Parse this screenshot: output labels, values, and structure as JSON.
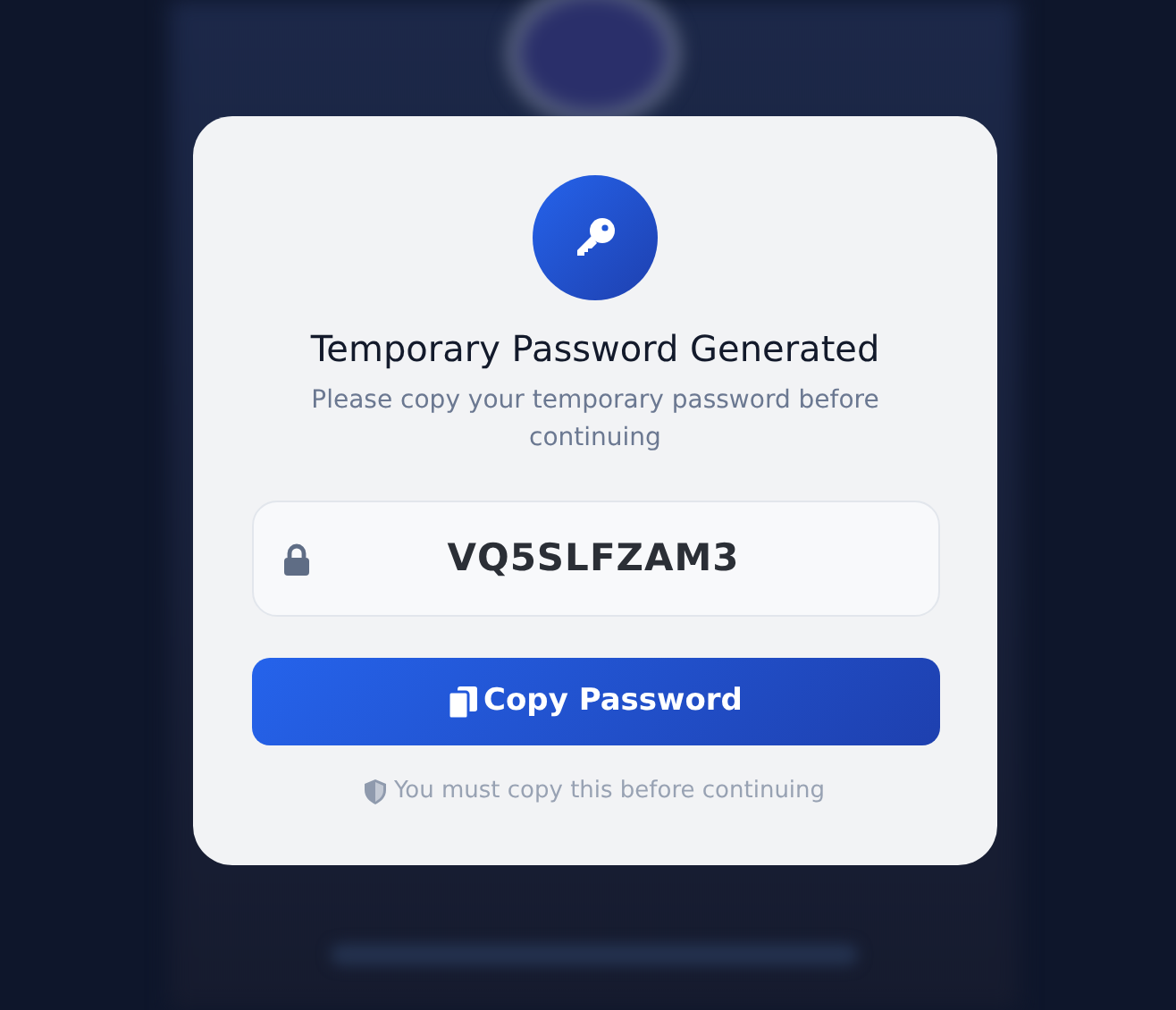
{
  "dialog": {
    "title": "Temporary Password Generated",
    "subtitle": "Please copy your temporary password before continuing",
    "password": "VQ5SLFZAM3",
    "copy_button": "Copy Password",
    "note": "You must copy this before continuing"
  }
}
